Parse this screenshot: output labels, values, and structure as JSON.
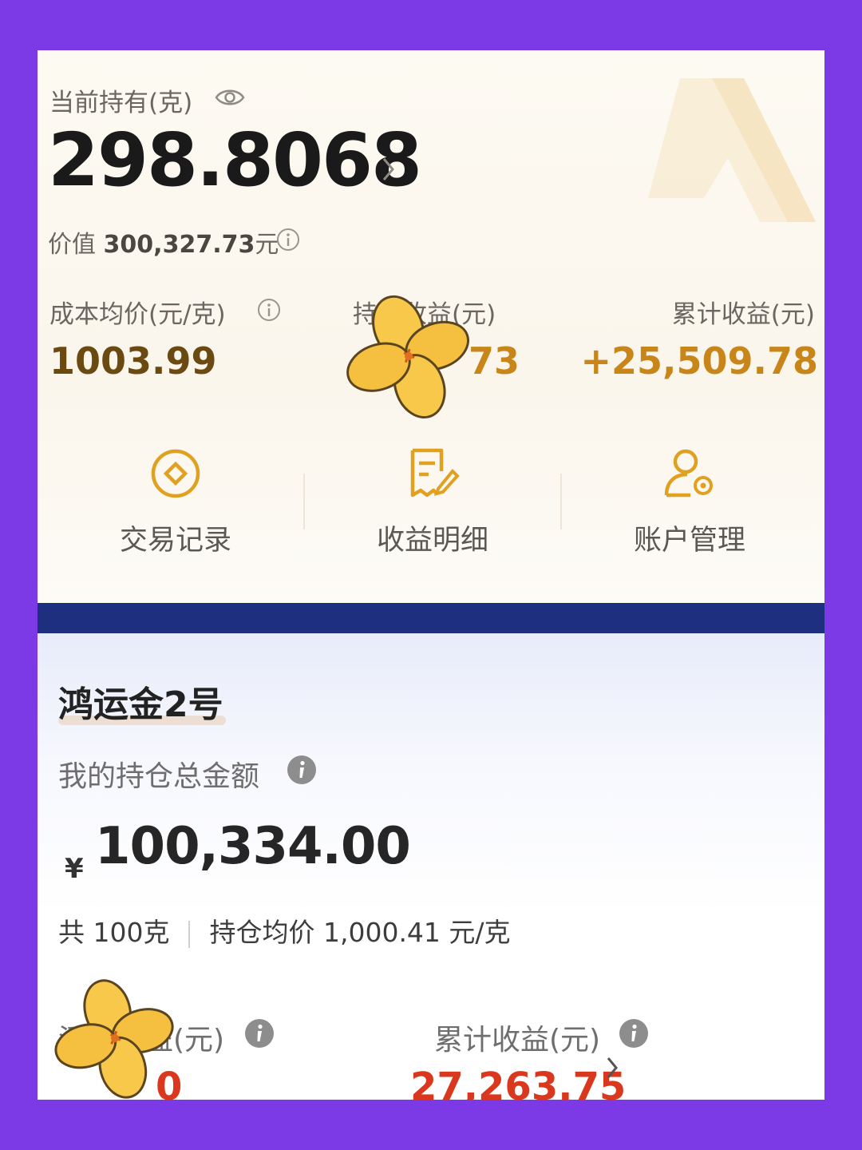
{
  "holdings": {
    "label": "当前持有(克)",
    "grams": "298.8068",
    "worth_prefix": "价值",
    "worth_amount": "300,327.73",
    "worth_unit": "元"
  },
  "stats": [
    {
      "label": "成本均价(元/克)",
      "value": "1003.99",
      "color": "#6b4a12"
    },
    {
      "label": "持仓收益(元)",
      "value": "73",
      "color": "#c8861a"
    },
    {
      "label": "累计收益(元)",
      "value": "+25,509.78",
      "color": "#c8861a"
    }
  ],
  "actions": [
    {
      "label": "交易记录",
      "icon": "coin-icon"
    },
    {
      "label": "收益明细",
      "icon": "document-edit-icon"
    },
    {
      "label": "账户管理",
      "icon": "user-settings-icon"
    }
  ],
  "fund": {
    "name": "鸿运金2号",
    "total_label": "我的持仓总金额",
    "currency": "¥",
    "total": "100,334.00",
    "weight_text": "共 100克",
    "avg_price_text": "持仓均价 1,000.41 元/克",
    "float_label": "浮动收益(元)",
    "float_value": "0",
    "cum_label": "累计收益(元)",
    "cum_value": "27,263.75"
  },
  "colors": {
    "gold": "#e0a020",
    "navy_band": "#1e2f80",
    "profit_red": "#d9381e",
    "background_purple": "#7b3ae6"
  }
}
